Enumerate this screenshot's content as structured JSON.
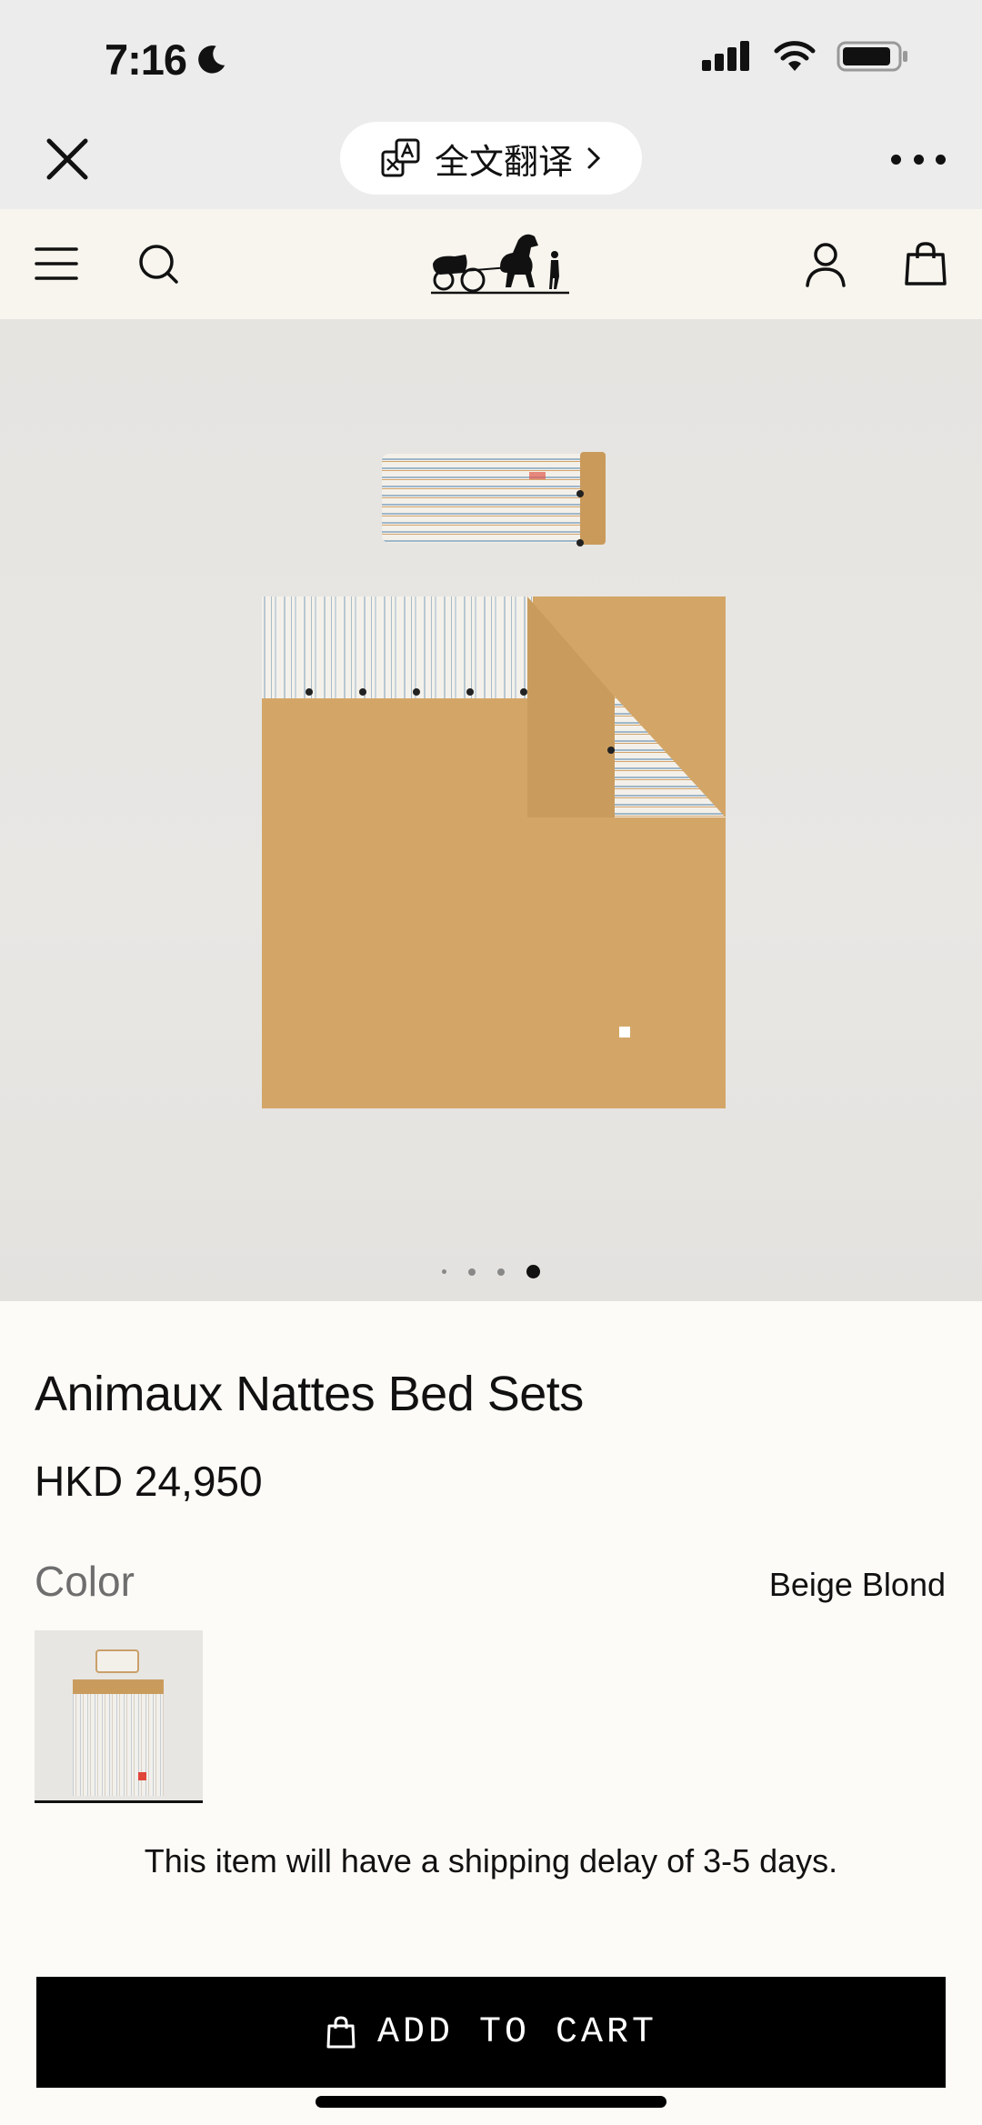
{
  "status_bar": {
    "time": "7:16",
    "icons": [
      "moon-icon",
      "cellular-icon",
      "wifi-icon",
      "battery-icon"
    ]
  },
  "browser_bar": {
    "translate_label": "全文翻译",
    "icons": [
      "close-icon",
      "translate-icon",
      "chevron-right-icon",
      "more-icon"
    ]
  },
  "site_header": {
    "icons": [
      "menu-icon",
      "search-icon",
      "logo-carriage",
      "account-icon",
      "bag-icon"
    ]
  },
  "gallery": {
    "image_count": 4,
    "active_index": 3
  },
  "product": {
    "title": "Animaux Nattes Bed Sets",
    "price": "HKD 24,950",
    "color_label": "Color",
    "color_value": "Beige Blond",
    "shipping_note": "This item will have a shipping delay of 3-5 days."
  },
  "cta": {
    "label": "ADD TO CART",
    "icon": "bag-icon"
  },
  "colors": {
    "accent": "#000000",
    "background": "#fdfbf7",
    "bedding": "#d3a668"
  }
}
